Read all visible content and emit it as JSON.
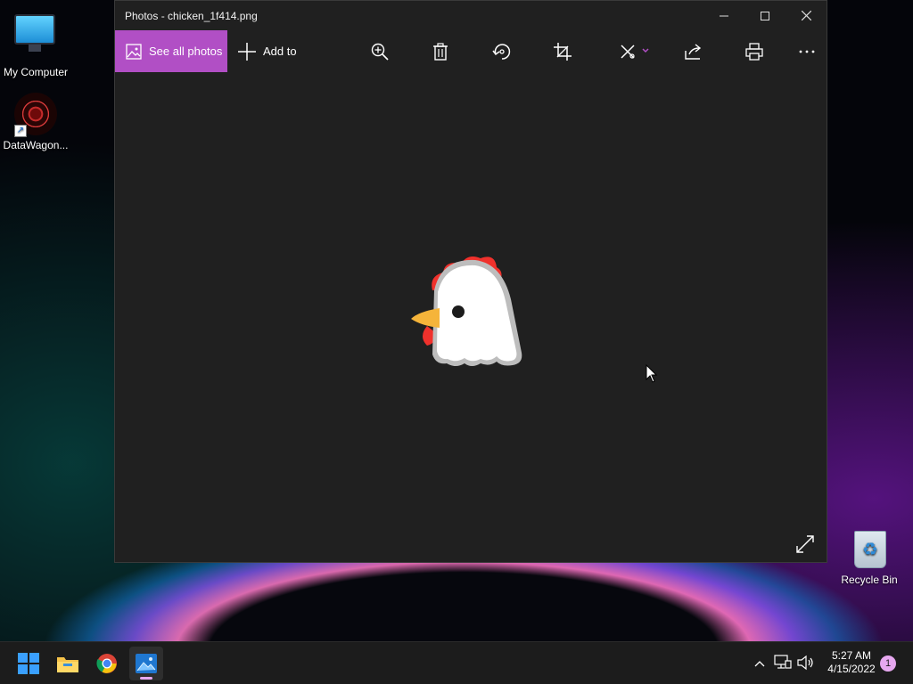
{
  "desktop": {
    "icons": [
      {
        "label": "My Computer"
      },
      {
        "label": "DataWagon..."
      },
      {
        "label": "Recycle Bin"
      }
    ]
  },
  "window": {
    "title": "Photos - chicken_1f414.png",
    "toolbar": {
      "see_all_label": "See all photos",
      "add_to_label": "Add to",
      "tools": [
        "zoom-in-icon",
        "delete-icon",
        "rotate-icon",
        "crop-icon",
        "edit-draw-icon",
        "share-icon",
        "print-icon",
        "more-icon"
      ]
    },
    "image": {
      "emoji": "chicken"
    },
    "accent": "#b14fc5"
  },
  "taskbar": {
    "apps": [
      "start",
      "file-explorer",
      "chrome",
      "photos"
    ],
    "clock": {
      "time": "5:27 AM",
      "date": "4/15/2022"
    },
    "notification_count": "1"
  }
}
